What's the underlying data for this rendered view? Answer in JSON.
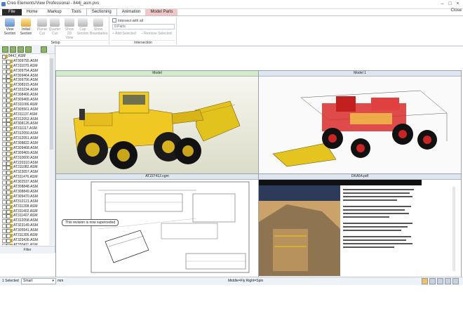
{
  "window": {
    "title": "Creo Elements/View Professional - 844j_asm.pvs",
    "close_label": "Close"
  },
  "tabs": [
    "File",
    "Home",
    "Markup",
    "Tools",
    "Sectioning",
    "Animation",
    "Model Parts"
  ],
  "active_tab": "Sectioning",
  "ribbon": {
    "view_section": "View\nSection",
    "initial_section": "Initial\nSection",
    "planar_cut": "Planar\nCut",
    "quarter_cut": "Quarter\nCut",
    "show_2d_view": "Show\n2D View",
    "cap_section": "Cap\nSection",
    "show_boundaries": "Show\nBoundaries",
    "setup_group": "Setup",
    "intersect_with_all": "Intersect with all",
    "parts_field": "0 Parts",
    "add_selected": "Add Selected",
    "remove_selected": "Remove Selected",
    "intersection_group": "Intersection"
  },
  "tree": {
    "root": "844J_ASM",
    "items": [
      "AT309755.ASM",
      "AT311070.ASM",
      "AT309754.ASM",
      "AT309464.ASM",
      "AT309756.ASM",
      "AT308315.ASM",
      "AT333234.ASM",
      "AT308466.ASM",
      "AT309465.ASM",
      "AT311006.ASM",
      "AT305561.ASM",
      "AT311137.ASM",
      "AT312052.ASM",
      "AT308126.ASM",
      "AT311117.ASM",
      "AT312050.ASM",
      "AT312051.ASM",
      "AT308822.ASM",
      "AT309468.ASM",
      "AT309469.ASM",
      "AT310600.ASM",
      "AT220310.ASM",
      "AT311082.ASM",
      "AT323057.ASM",
      "AT311476.ASM",
      "AT302537.ASM",
      "AT308848.ASM",
      "AT308849.ASM",
      "AT309470.ASM",
      "AT312121.ASM",
      "AT311208.ASM",
      "AT311402.ASM",
      "AT311407.ASM",
      "AT312058.ASM",
      "AT323149.ASM",
      "AT305541.ASM",
      "AT311305.ASM",
      "AT320436.ASM",
      "AT330411.ASM",
      "AT312301.ASM",
      "AT311308.ASM"
    ],
    "filter_label": "Filter"
  },
  "viewports": {
    "model": "Model",
    "model1": "Model 1",
    "drawing": "AT227412.cgm",
    "doc": "DKA54.pdf",
    "drawing_callout": "This revision is now superceded"
  },
  "status": {
    "selected": "1 Selected",
    "mode": "Smart",
    "units": "mm",
    "mouse_hint": "Middle=Fly   Right=Spin"
  }
}
